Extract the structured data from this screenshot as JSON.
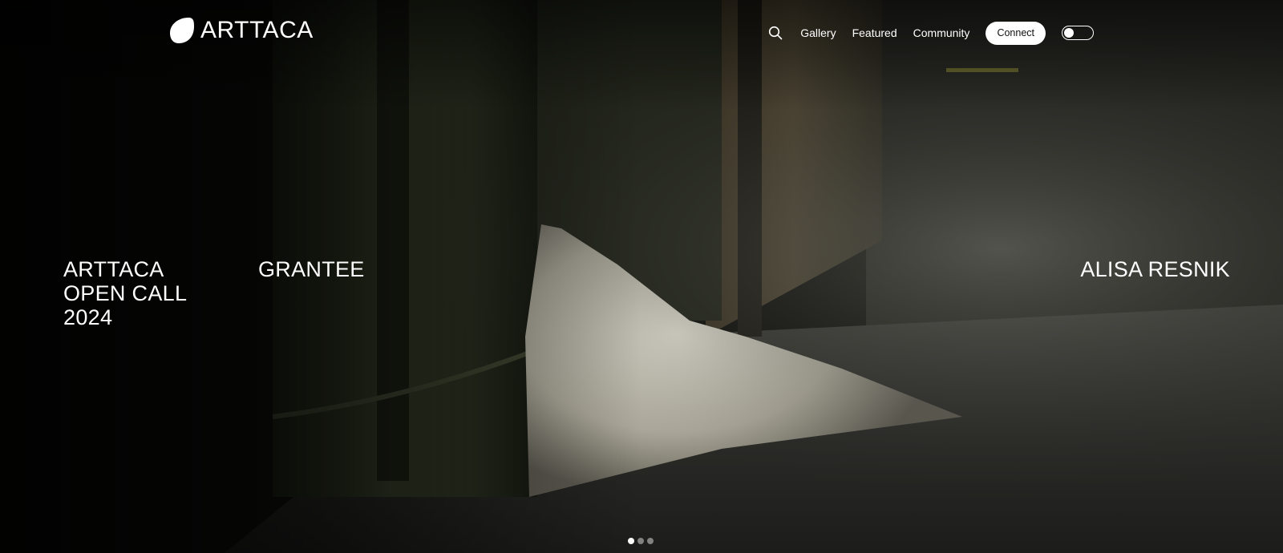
{
  "brand": {
    "name": "ARTTACA",
    "logo_icon": "blob-logo-icon"
  },
  "nav": {
    "search_icon": "search-icon",
    "links": [
      "Gallery",
      "Featured",
      "Community"
    ],
    "connect_label": "Connect",
    "theme_toggle": "theme-toggle"
  },
  "hero": {
    "open_call": [
      "ARTTACA",
      "OPEN CALL",
      "2024"
    ],
    "label": "GRANTEE",
    "artist": "ALISA RESNIK"
  },
  "carousel": {
    "slides": 3,
    "active": 1
  },
  "colors": {
    "text": "#ffffff",
    "button_bg": "#ffffff",
    "button_text": "#111111",
    "background": "#000000"
  }
}
